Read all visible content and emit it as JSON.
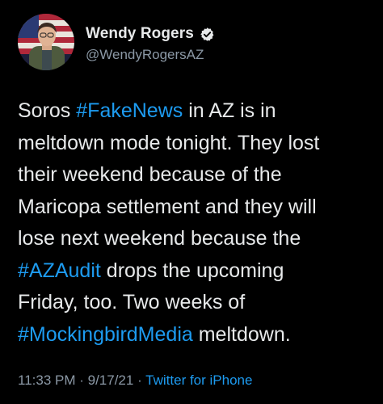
{
  "user": {
    "display_name": "Wendy Rogers",
    "handle": "@WendyRogersAZ",
    "verified": true
  },
  "tweet": {
    "lines": [
      [
        {
          "text": "Soros ",
          "hashtag": false
        },
        {
          "text": "#FakeNews",
          "hashtag": true
        },
        {
          "text": " in AZ is in",
          "hashtag": false
        }
      ],
      [
        {
          "text": "meltdown mode tonight. They lost",
          "hashtag": false
        }
      ],
      [
        {
          "text": "their weekend because of the",
          "hashtag": false
        }
      ],
      [
        {
          "text": "Maricopa settlement and they will",
          "hashtag": false
        }
      ],
      [
        {
          "text": "lose next weekend because the",
          "hashtag": false
        }
      ],
      [
        {
          "text": "#AZAudit",
          "hashtag": true
        },
        {
          "text": " drops the upcoming",
          "hashtag": false
        }
      ],
      [
        {
          "text": "Friday, too. Two weeks of",
          "hashtag": false
        }
      ],
      [
        {
          "text": "#MockingbirdMedia",
          "hashtag": true
        },
        {
          "text": " meltdown.",
          "hashtag": false
        }
      ]
    ]
  },
  "meta": {
    "time": "11:33 PM",
    "separator": " · ",
    "date": "9/17/21",
    "source": "Twitter for iPhone"
  },
  "colors": {
    "background": "#000000",
    "text": "#e7e9ea",
    "secondary": "#8b98a5",
    "link": "#1d9bf0"
  },
  "icons": {
    "verified": "verified-badge-icon"
  }
}
